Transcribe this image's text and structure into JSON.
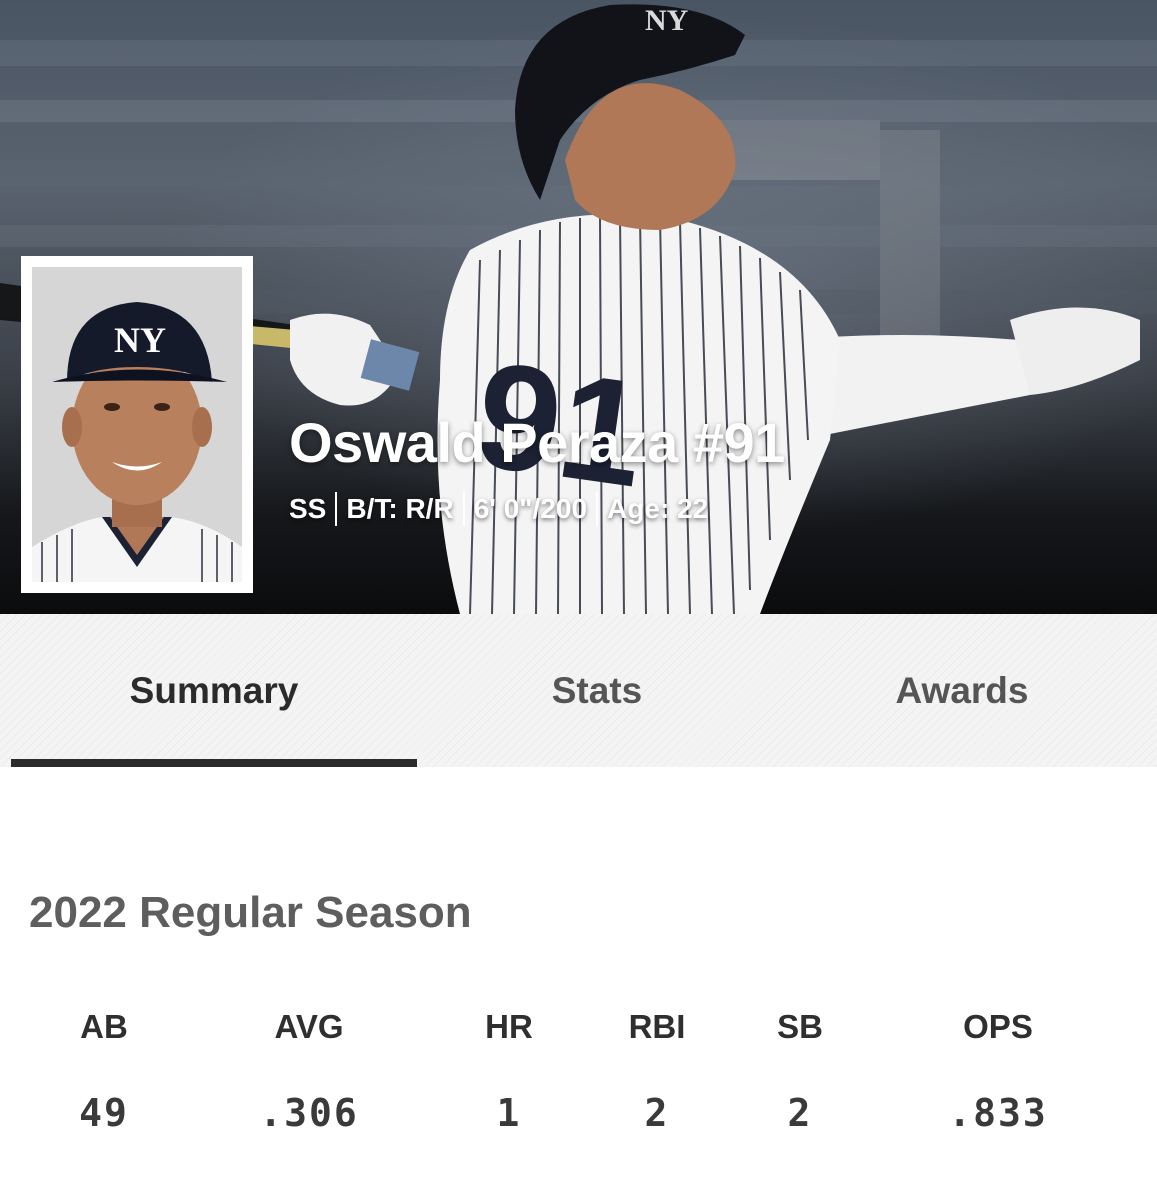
{
  "player": {
    "name": "Oswald Peraza #91",
    "position": "SS",
    "bats_throws": "B/T: R/R",
    "height_weight": "6' 0\"/200",
    "age": "Age: 22",
    "jersey_number": "91"
  },
  "tabs": [
    {
      "label": "Summary",
      "active": true
    },
    {
      "label": "Stats",
      "active": false
    },
    {
      "label": "Awards",
      "active": false
    }
  ],
  "season": {
    "title": "2022 Regular Season",
    "stats": [
      {
        "label": "AB",
        "value": "49"
      },
      {
        "label": "AVG",
        "value": ".306"
      },
      {
        "label": "HR",
        "value": "1"
      },
      {
        "label": "RBI",
        "value": "2"
      },
      {
        "label": "SB",
        "value": "2"
      },
      {
        "label": "OPS",
        "value": ".833"
      }
    ]
  },
  "colors": {
    "navy": "#1c2233",
    "tab_indicator": "#2b2b2b",
    "season_title": "#5e5e5e"
  }
}
